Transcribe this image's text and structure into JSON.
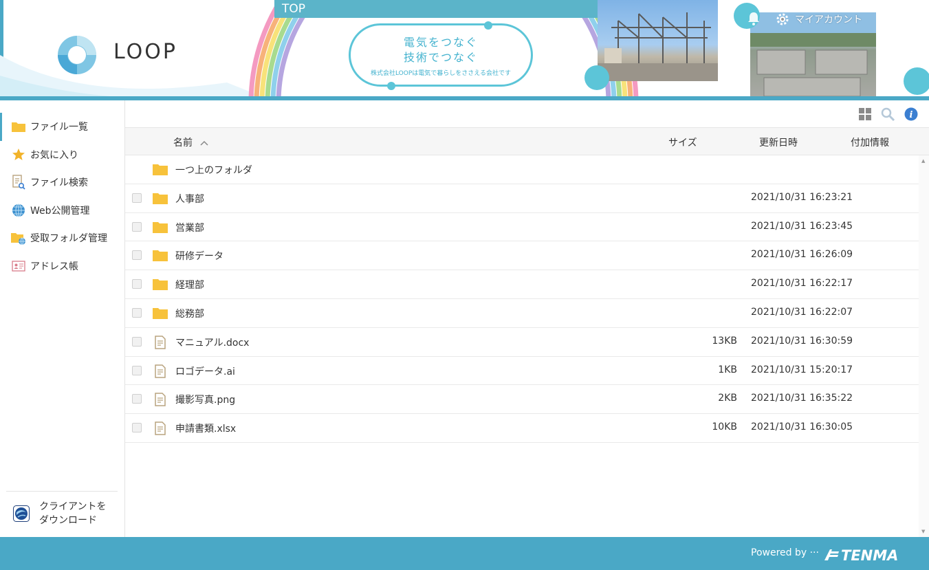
{
  "header": {
    "logo_text": "LOOP",
    "top_tab": "TOP",
    "bubble_line1": "電気をつなぐ",
    "bubble_line2": "技術でつなぐ",
    "bubble_line3": "株式会社LOOPは電気で暮らしをささえる会社です",
    "account_label": "マイアカウント"
  },
  "sidebar": {
    "items": [
      {
        "label": "ファイル一覧",
        "icon": "folder-icon",
        "active": true
      },
      {
        "label": "お気に入り",
        "icon": "star-icon"
      },
      {
        "label": "ファイル検索",
        "icon": "file-search-icon"
      },
      {
        "label": "Web公開管理",
        "icon": "globe-icon"
      },
      {
        "label": "受取フォルダ管理",
        "icon": "folder-globe-icon"
      },
      {
        "label": "アドレス帳",
        "icon": "address-card-icon"
      }
    ],
    "client_download": {
      "line1": "クライアントを",
      "line2": "ダウンロード"
    }
  },
  "table": {
    "columns": {
      "name": "名前",
      "size": "サイズ",
      "modified": "更新日時",
      "extra": "付加情報"
    },
    "parent_folder": "一つ上のフォルダ",
    "rows": [
      {
        "name": "人事部",
        "type": "folder",
        "size": "",
        "modified": "2021/10/31 16:23:21"
      },
      {
        "name": "営業部",
        "type": "folder",
        "size": "",
        "modified": "2021/10/31 16:23:45"
      },
      {
        "name": "研修データ",
        "type": "folder",
        "size": "",
        "modified": "2021/10/31 16:26:09"
      },
      {
        "name": "経理部",
        "type": "folder",
        "size": "",
        "modified": "2021/10/31 16:22:17"
      },
      {
        "name": "総務部",
        "type": "folder",
        "size": "",
        "modified": "2021/10/31 16:22:07"
      },
      {
        "name": "マニュアル.docx",
        "type": "file",
        "size": "13KB",
        "modified": "2021/10/31 16:30:59"
      },
      {
        "name": "ロゴデータ.ai",
        "type": "file",
        "size": "1KB",
        "modified": "2021/10/31 15:20:17"
      },
      {
        "name": "撮影写真.png",
        "type": "file",
        "size": "2KB",
        "modified": "2021/10/31 16:35:22"
      },
      {
        "name": "申請書類.xlsx",
        "type": "file",
        "size": "10KB",
        "modified": "2021/10/31 16:30:05"
      }
    ]
  },
  "footer": {
    "powered_by": "Powered by ···",
    "brand": "TENMA"
  },
  "colors": {
    "accent": "#4aa8c6",
    "folder": "#f7c23b",
    "info": "#3b7fd1"
  }
}
